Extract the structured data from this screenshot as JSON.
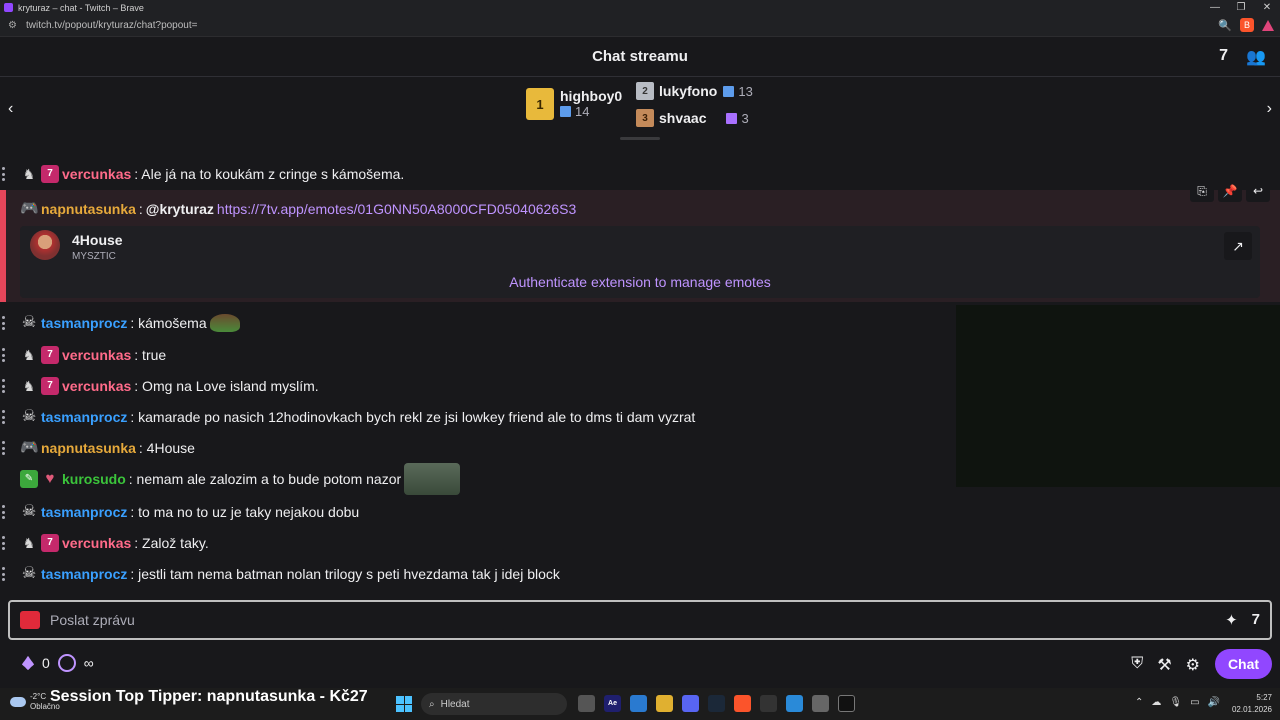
{
  "browser": {
    "title": "kryturaz – chat - Twitch – Brave",
    "url": "twitch.tv/popout/kryturaz/chat?popout="
  },
  "header": {
    "title": "Chat streamu"
  },
  "leaderboard": {
    "first": {
      "rank": "1",
      "name": "highboy0",
      "count": "14"
    },
    "second": {
      "rank": "2",
      "name": "lukyfono",
      "count": "13"
    },
    "third": {
      "rank": "3",
      "name": "shvaac",
      "count": "3"
    }
  },
  "messages": [
    {
      "user": "vercunkas",
      "color": "#ff6b8a",
      "text": ": Ale já na to koukám z cringe s kámošema."
    },
    {
      "user": "tasmanprocz",
      "color": "#3aa0ff",
      "text": ": kámošema"
    },
    {
      "user": "vercunkas",
      "color": "#ff6b8a",
      "text": ": true"
    },
    {
      "user": "vercunkas",
      "color": "#ff6b8a",
      "text": ": Omg na Love island myslím."
    },
    {
      "user": "tasmanprocz",
      "color": "#3aa0ff",
      "text": ": kamarade po nasich 12hodinovkach bych rekl ze jsi lowkey friend ale to dms ti dam vyzrat"
    },
    {
      "user": "napnutasunka",
      "color": "#e6a93b",
      "text": ": 4House"
    },
    {
      "user": "kurosudo",
      "color": "#3bc43b",
      "text": ": nemam ale zalozim a to bude potom nazor"
    },
    {
      "user": "tasmanprocz",
      "color": "#3aa0ff",
      "text": ": to ma no to uz je taky nejakou dobu"
    },
    {
      "user": "vercunkas",
      "color": "#ff6b8a",
      "text": ": Založ taky."
    },
    {
      "user": "tasmanprocz",
      "color": "#3aa0ff",
      "text": ": jestli tam nema batman nolan trilogy s peti hvezdama tak j idej block"
    }
  ],
  "highlight": {
    "user": "napnutasunka",
    "color": "#e6a93b",
    "sep": ":",
    "mention": "@kryturaz",
    "link": "https://7tv.app/emotes/01G0NN50A8000CFD05040626S3",
    "card_title": "4House",
    "card_sub": "MYSZTIC",
    "auth": "Authenticate extension to manage emotes"
  },
  "input": {
    "placeholder": "Poslat zprávu"
  },
  "bottom": {
    "points": "0",
    "infinity": "∞",
    "chat_button": "Chat"
  },
  "taskbar": {
    "temp": "-2°C",
    "weather": "Oblačno",
    "tipper": "Session Top Tipper: napnutasunka - Kč27",
    "search": "Hledat",
    "time": "5:27",
    "date": "02.01.2026"
  }
}
